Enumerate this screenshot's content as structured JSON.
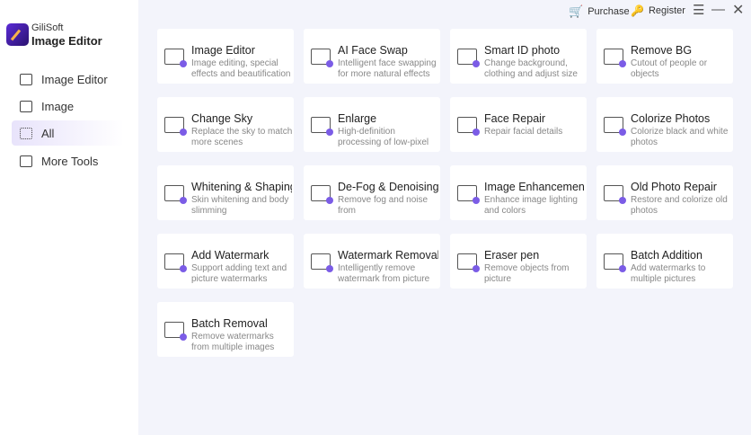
{
  "app": {
    "brand": "GiliSoft",
    "title": "Image Editor"
  },
  "header": {
    "purchase": "Purchase",
    "register": "Register"
  },
  "sidebar": {
    "items": [
      {
        "label": "Image Editor"
      },
      {
        "label": "Image"
      },
      {
        "label": "All"
      },
      {
        "label": "More Tools"
      }
    ]
  },
  "cards": [
    {
      "title": "Image Editor",
      "desc": "Image editing, special effects and beautification"
    },
    {
      "title": "AI Face Swap",
      "desc": "Intelligent face swapping for more natural effects"
    },
    {
      "title": "Smart ID photo",
      "desc": "Change background, clothing and adjust size"
    },
    {
      "title": "Remove BG",
      "desc": "Cutout of people or objects"
    },
    {
      "title": "Change Sky",
      "desc": "Replace the sky to match more scenes"
    },
    {
      "title": "Enlarge",
      "desc": "High-definition processing of low-pixel"
    },
    {
      "title": "Face Repair",
      "desc": "Repair facial details"
    },
    {
      "title": "Colorize Photos",
      "desc": "Colorize black and white photos"
    },
    {
      "title": "Whitening & Shaping",
      "desc": "Skin whitening and body slimming"
    },
    {
      "title": "De-Fog & Denoising",
      "desc": "Remove fog and noise from"
    },
    {
      "title": "Image Enhancement",
      "desc": "Enhance image lighting and colors"
    },
    {
      "title": "Old Photo Repair",
      "desc": "Restore and colorize old photos"
    },
    {
      "title": "Add Watermark",
      "desc": "Support adding text and picture watermarks"
    },
    {
      "title": "Watermark Removal",
      "desc": "Intelligently remove watermark from picture"
    },
    {
      "title": "Eraser pen",
      "desc": "Remove objects from picture"
    },
    {
      "title": "Batch Addition",
      "desc": "Add watermarks to multiple pictures"
    },
    {
      "title": "Batch Removal",
      "desc": "Remove watermarks from multiple images"
    }
  ]
}
